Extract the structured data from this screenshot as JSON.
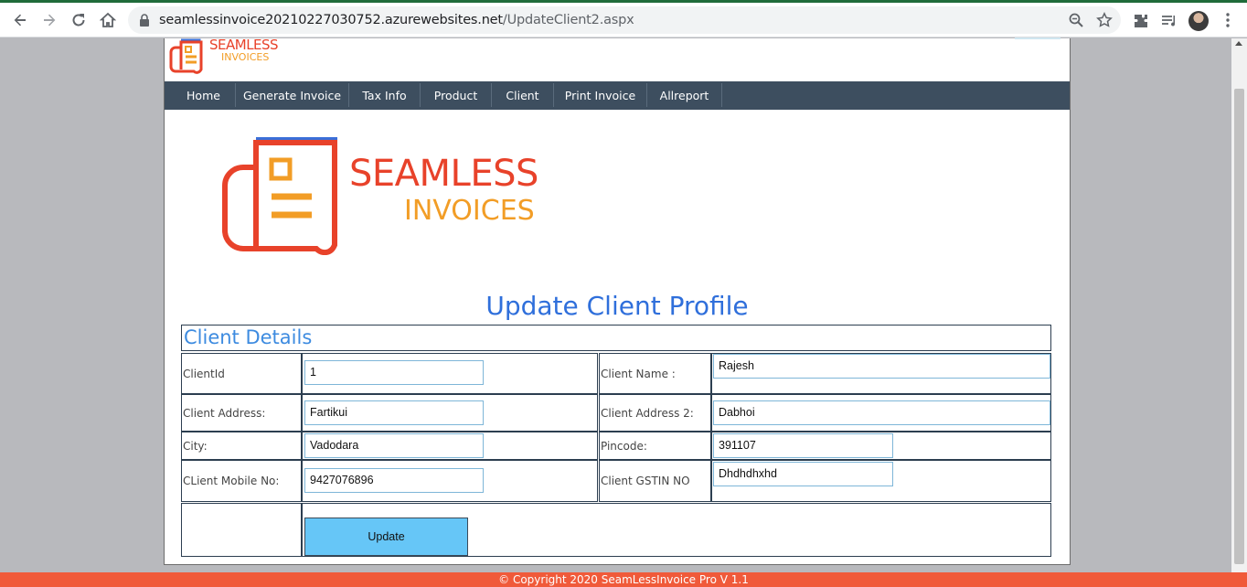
{
  "browser": {
    "url_host": "seamlessinvoice20210227030752.azurewebsites.net",
    "url_path": "/UpdateClient2.aspx",
    "icons": [
      "back-icon",
      "forward-icon",
      "reload-icon",
      "home-icon",
      "lock-icon",
      "zoom-icon",
      "star-icon",
      "extensions-icon",
      "media-icon",
      "avatar",
      "menu-icon"
    ]
  },
  "logo": {
    "word1": "SEAMLESS",
    "word2": "INVOICES",
    "red": "#e8422a",
    "orange": "#f29d26",
    "blue": "#2f6fdb"
  },
  "nav": {
    "items": [
      "Home",
      "Generate Invoice",
      "Tax Info",
      "Product",
      "Client",
      "Print Invoice",
      "Allreport"
    ]
  },
  "page": {
    "title": "Update Client Profile",
    "section_title": "Client Details"
  },
  "form": {
    "client_id_label": "ClientId",
    "client_id_value": "1",
    "client_name_label": "Client  Name :",
    "client_name_value": "Rajesh",
    "address_label": "Client Address:",
    "address_value": "Fartikui",
    "address2_label": "Client Address 2:",
    "address2_value": "Dabhoi",
    "city_label": "City:",
    "city_value": "Vadodara",
    "pincode_label": "Pincode:",
    "pincode_value": "391107",
    "mobile_label": "CLient Mobile No:",
    "mobile_value": "9427076896",
    "gstin_label": "Client GSTIN NO",
    "gstin_value": "Dhdhdhxhd",
    "update_label": "Update"
  },
  "footer": {
    "text": "© Copyright 2020 SeamLessInvoice Pro V 1.1"
  }
}
